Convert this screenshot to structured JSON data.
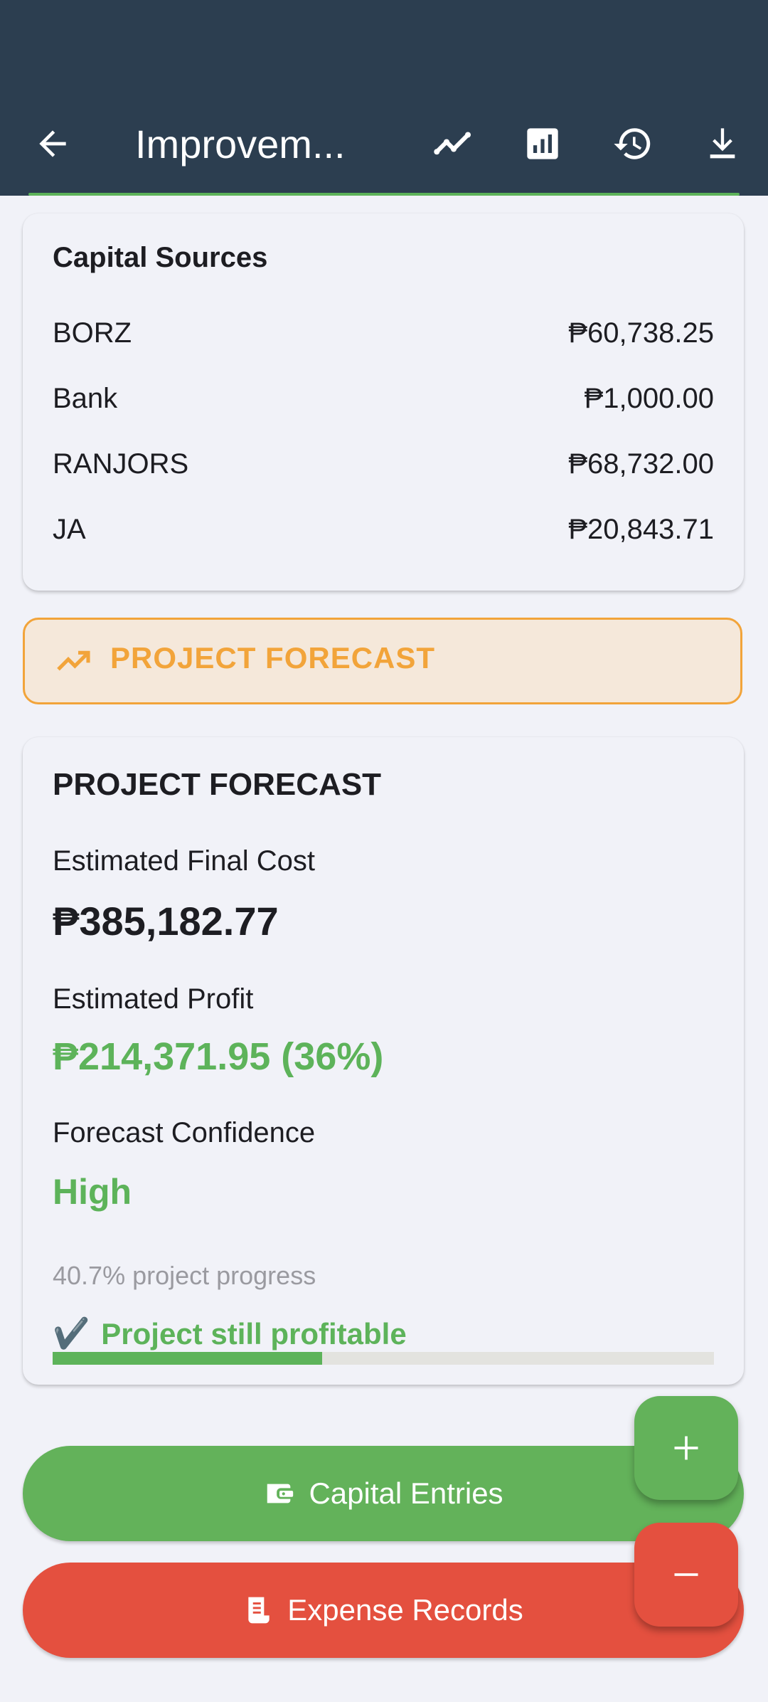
{
  "header": {
    "title": "Improvem...",
    "icons": [
      "back-arrow-icon",
      "trending-line-icon",
      "bar-chart-icon",
      "history-icon",
      "download-icon"
    ]
  },
  "capital_sources": {
    "title": "Capital Sources",
    "items": [
      {
        "name": "BORZ",
        "amount": "₱60,738.25"
      },
      {
        "name": "Bank",
        "amount": "₱1,000.00"
      },
      {
        "name": "RANJORS",
        "amount": "₱68,732.00"
      },
      {
        "name": "JA",
        "amount": "₱20,843.71"
      }
    ]
  },
  "forecast_banner": {
    "label": "PROJECT FORECAST",
    "icon": "trending-up-icon",
    "color": "#f2a43a"
  },
  "forecast": {
    "title": "PROJECT FORECAST",
    "final_cost_label": "Estimated Final Cost",
    "final_cost_value": "₱385,182.77",
    "profit_label": "Estimated Profit",
    "profit_value": "₱214,371.95 (36%)",
    "confidence_label": "Forecast Confidence",
    "confidence_value": "High",
    "progress_fraction": 0.407,
    "progress_text": "40.7% project progress",
    "status_icon": "✔️",
    "status_text": "Project still profitable",
    "positive_color": "#5db35a"
  },
  "actions": {
    "capital_label": "Capital Entries",
    "expense_label": "Expense Records",
    "capital_color": "#63b25a",
    "expense_color": "#e4503f",
    "add_icon": "plus-icon",
    "subtract_icon": "minus-icon"
  }
}
